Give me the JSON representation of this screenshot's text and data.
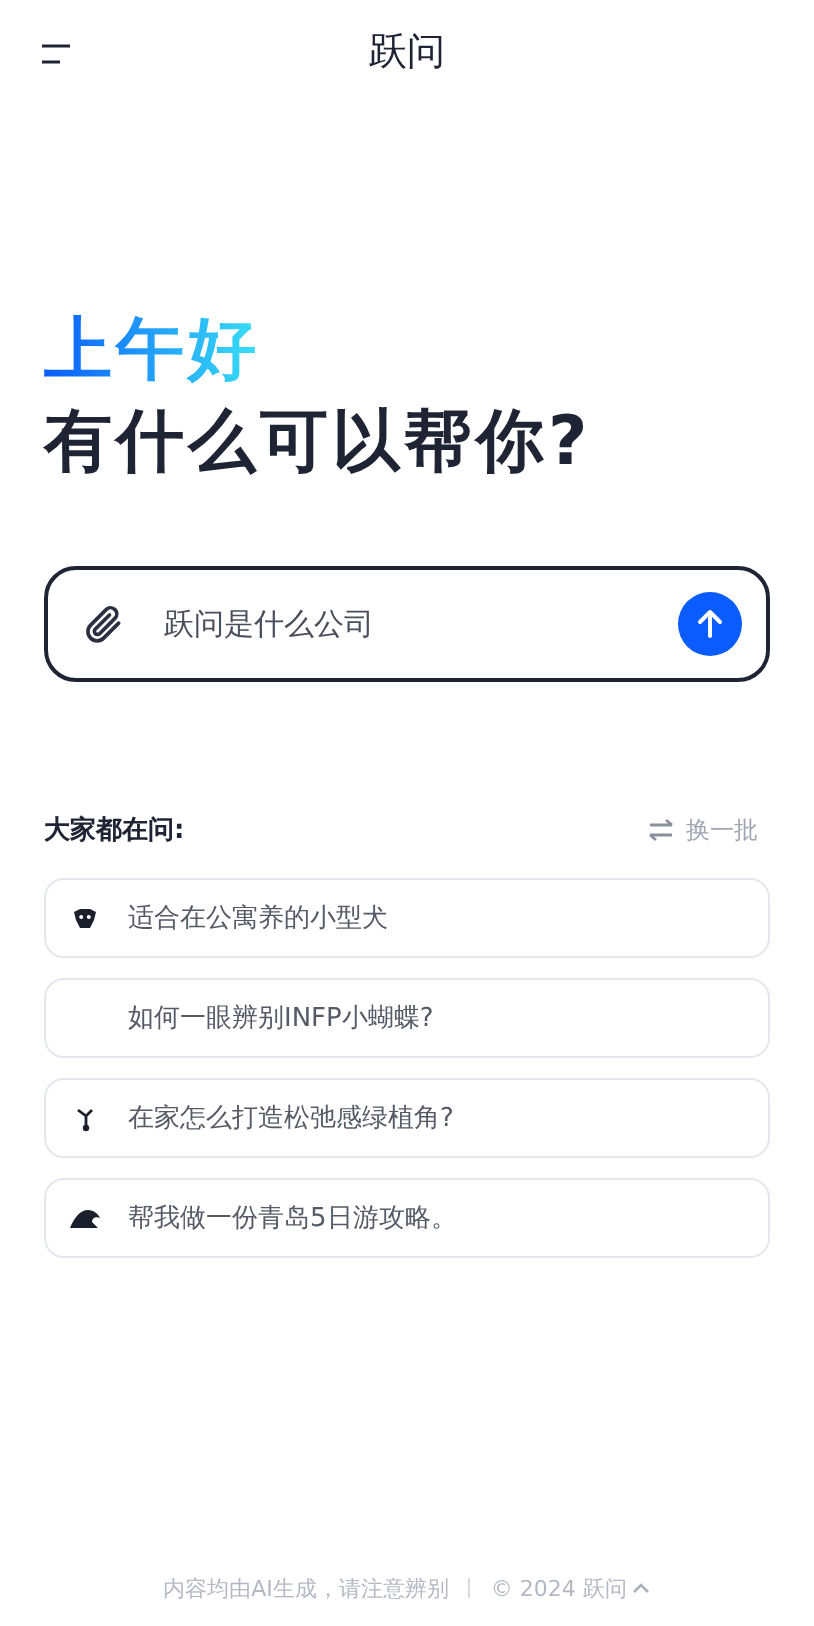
{
  "header": {
    "title": "跃问"
  },
  "greeting": "上午好",
  "headline": "有什么可以帮你?",
  "composer": {
    "value": "跃问是什么公司"
  },
  "suggestions": {
    "title": "大家都在问:",
    "refresh": "换一批",
    "items": [
      {
        "text": "适合在公寓养的小型犬",
        "kind": "with-icon"
      },
      {
        "text": "如何一眼辨别INFP小蝴蝶?",
        "kind": "text-only"
      },
      {
        "text": "在家怎么打造松弛感绿植角?",
        "kind": "with-icon"
      },
      {
        "text": "帮我做一份青岛5日游攻略。",
        "kind": "with-icon"
      }
    ]
  },
  "footer": {
    "disclaimer": "内容均由AI生成，请注意辨别",
    "copyright": "© 2024 跃问"
  }
}
